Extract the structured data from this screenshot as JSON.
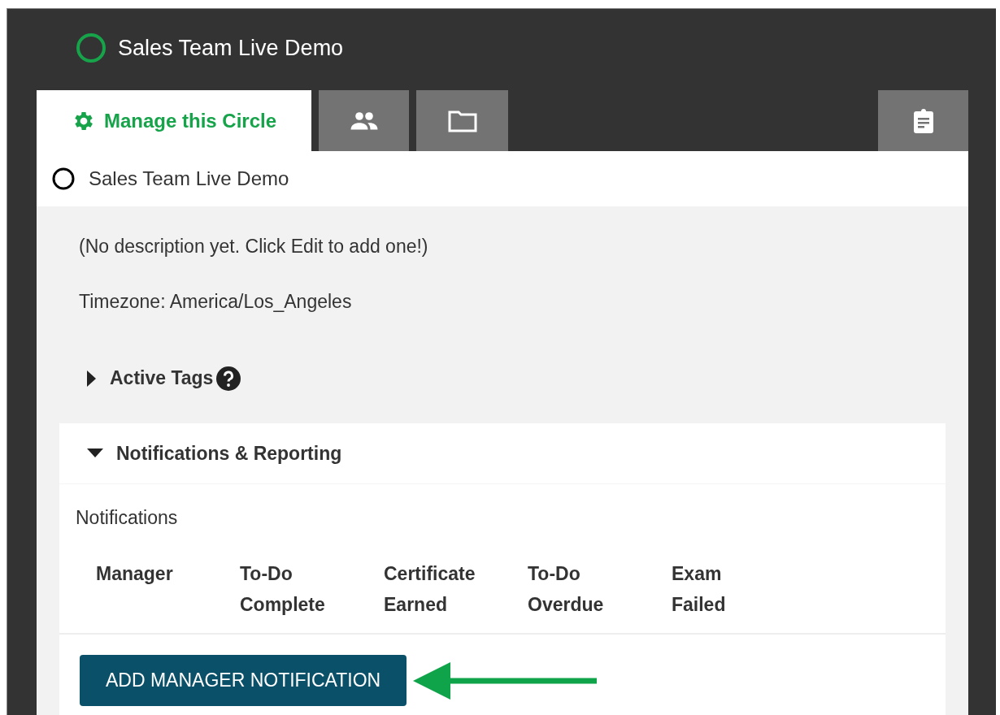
{
  "header": {
    "title": "Sales Team Live Demo"
  },
  "tabs": [
    {
      "label": "Manage this Circle",
      "selected": true
    },
    {
      "selected": false
    },
    {
      "selected": false
    },
    {
      "selected": false
    }
  ],
  "circle": {
    "name": "Sales Team Live Demo"
  },
  "description": "(No description yet. Click Edit to add one!)",
  "timezone": "Timezone: America/Los_Angeles",
  "sections": [
    {
      "title": "Active Tags",
      "expanded": false,
      "help": true
    },
    {
      "title": "Notifications & Reporting",
      "expanded": true,
      "help": false
    }
  ],
  "notifications": {
    "label": "Notifications",
    "columns": [
      [
        "Manager"
      ],
      [
        "To-Do",
        "Complete"
      ],
      [
        "Certificate",
        "Earned"
      ],
      [
        "To-Do",
        "Overdue"
      ],
      [
        "Exam",
        "Failed"
      ]
    ],
    "button": "ADD MANAGER NOTIFICATION"
  }
}
